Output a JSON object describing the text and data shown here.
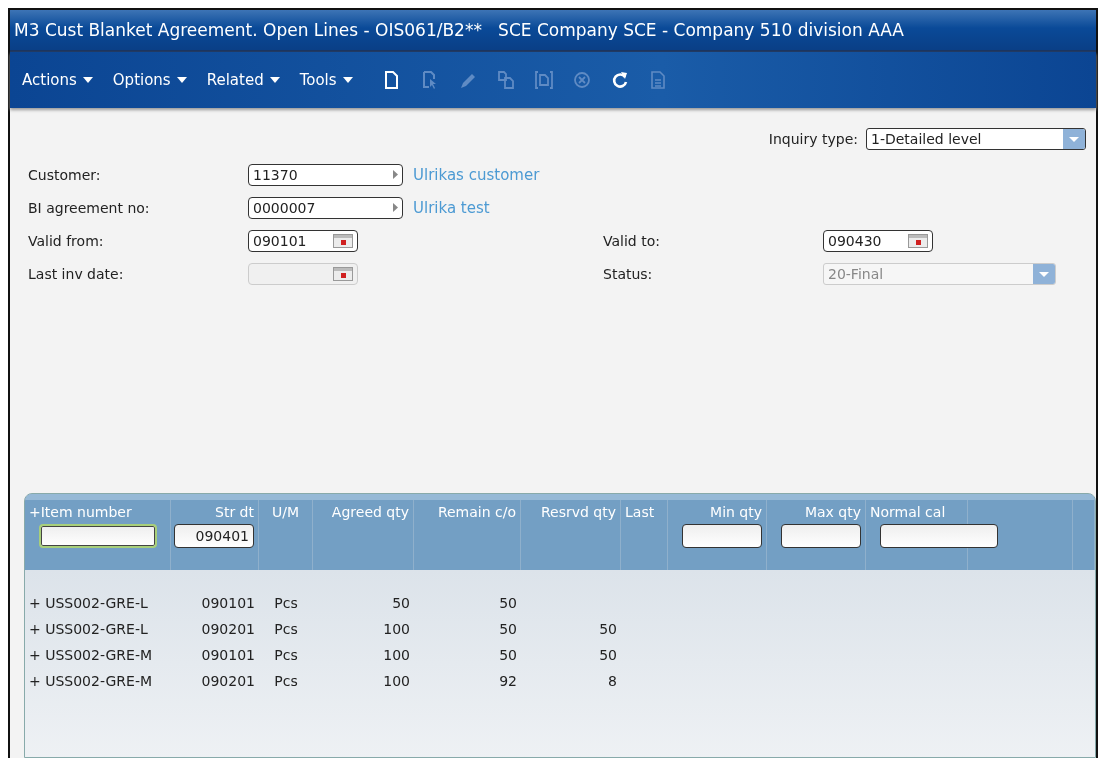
{
  "window": {
    "title": "M3 Cust Blanket Agreement. Open Lines - OIS061/B2**   SCE Company SCE - Company 510 division AAA"
  },
  "menus": [
    {
      "label": "Actions"
    },
    {
      "label": "Options"
    },
    {
      "label": "Related"
    },
    {
      "label": "Tools"
    }
  ],
  "toolbar": [
    {
      "kind": "new",
      "disabled": false
    },
    {
      "kind": "select",
      "disabled": true
    },
    {
      "kind": "edit",
      "disabled": true
    },
    {
      "kind": "copy",
      "disabled": true
    },
    {
      "kind": "display",
      "disabled": true
    },
    {
      "kind": "delete",
      "disabled": true
    },
    {
      "kind": "refresh",
      "disabled": false
    },
    {
      "kind": "document",
      "disabled": true
    }
  ],
  "inquiry_type": {
    "label": "Inquiry type:",
    "value": "1-Detailed level"
  },
  "form_rows": [
    {
      "fields": [
        {
          "label": "Customer:",
          "kind": "browse",
          "value": "11370",
          "description": "Ulrikas customer",
          "disabled": false
        }
      ]
    },
    {
      "fields": [
        {
          "label": "BI agreement no:",
          "kind": "browse",
          "value": "0000007",
          "description": "Ulrika test",
          "disabled": false
        }
      ]
    },
    {
      "fields": [
        {
          "label": "Valid from:",
          "kind": "date",
          "value": "090101",
          "disabled": false
        },
        {
          "label": "Valid to:",
          "kind": "date",
          "value": "090430",
          "disabled": false
        }
      ]
    },
    {
      "fields": [
        {
          "label": "Last inv date:",
          "kind": "date",
          "disabled": true
        },
        {
          "label": "Status:",
          "kind": "dropdown",
          "value": "20-Final",
          "disabled": true
        }
      ]
    }
  ],
  "table": {
    "columns": [
      {
        "label": "+Item number",
        "filter": {
          "focused": true
        }
      },
      {
        "label": "Str dt",
        "filter": {
          "value": "090401",
          "focused": false
        }
      },
      {
        "label": "U/M"
      },
      {
        "label": "Agreed qty"
      },
      {
        "label": "Remain c/o"
      },
      {
        "label": "Resrvd qty"
      },
      {
        "label": "Last"
      },
      {
        "label": "Min qty",
        "filter": {
          "focused": false
        }
      },
      {
        "label": "Max qty",
        "filter": {
          "focused": false
        }
      },
      {
        "label": "Normal cal",
        "filter": {
          "focused": false
        }
      }
    ],
    "rows": [
      {
        "cells": [
          "+ USS002-GRE-L",
          "090101",
          "Pcs",
          "50",
          "50"
        ]
      },
      {
        "cells": [
          "+ USS002-GRE-L",
          "090201",
          "Pcs",
          "100",
          "50",
          "50"
        ]
      },
      {
        "cells": [
          "+ USS002-GRE-M",
          "090101",
          "Pcs",
          "100",
          "50",
          "50"
        ]
      },
      {
        "cells": [
          "+ USS002-GRE-M",
          "090201",
          "Pcs",
          "100",
          "92",
          "8"
        ]
      }
    ]
  }
}
